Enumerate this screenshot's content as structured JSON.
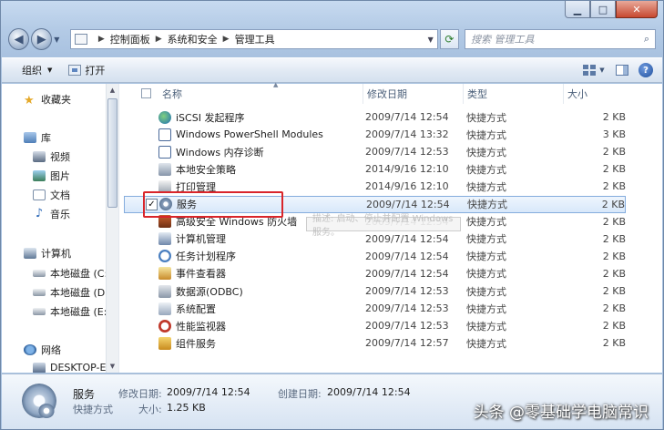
{
  "window": {
    "caption_min": "▁",
    "caption_max": "□",
    "caption_close": "✕"
  },
  "address": {
    "crumbs": [
      "控制面板",
      "系统和安全",
      "管理工具"
    ],
    "search_placeholder": "搜索 管理工具"
  },
  "toolbar": {
    "organize_label": "组织",
    "open_label": "打开"
  },
  "nav": {
    "favorites": "收藏夹",
    "libraries": "库",
    "videos": "视频",
    "pictures": "图片",
    "documents": "文档",
    "music": "音乐",
    "computer": "计算机",
    "drive_c": "本地磁盘 (C:)",
    "drive_d": "本地磁盘 (D:)",
    "drive_e": "本地磁盘 (E:)",
    "network": "网络",
    "desktop": "DESKTOP-EQ"
  },
  "columns": {
    "name": "名称",
    "modified": "修改日期",
    "type": "类型",
    "size": "大小"
  },
  "files": [
    {
      "name": "iSCSI 发起程序",
      "date": "2009/7/14 12:54",
      "type": "快捷方式",
      "size": "2 KB",
      "icon": "globe-icon"
    },
    {
      "name": "Windows PowerShell Modules",
      "date": "2009/7/14 13:32",
      "type": "快捷方式",
      "size": "3 KB",
      "icon": "powershell-icon"
    },
    {
      "name": "Windows 内存诊断",
      "date": "2009/7/14 12:53",
      "type": "快捷方式",
      "size": "2 KB",
      "icon": "memory-icon"
    },
    {
      "name": "本地安全策略",
      "date": "2014/9/16 12:10",
      "type": "快捷方式",
      "size": "2 KB",
      "icon": "security-policy-icon"
    },
    {
      "name": "打印管理",
      "date": "2014/9/16 12:10",
      "type": "快捷方式",
      "size": "2 KB",
      "icon": "print-icon"
    },
    {
      "name": "服务",
      "date": "2009/7/14 12:54",
      "type": "快捷方式",
      "size": "2 KB",
      "icon": "services-gear-icon"
    },
    {
      "name": "高级安全 Windows 防火墙",
      "date": "2009/7/14 12:54",
      "type": "快捷方式",
      "size": "2 KB",
      "icon": "firewall-icon"
    },
    {
      "name": "计算机管理",
      "date": "2009/7/14 12:54",
      "type": "快捷方式",
      "size": "2 KB",
      "icon": "computer-mgmt-icon"
    },
    {
      "name": "任务计划程序",
      "date": "2009/7/14 12:54",
      "type": "快捷方式",
      "size": "2 KB",
      "icon": "clock-icon"
    },
    {
      "name": "事件查看器",
      "date": "2009/7/14 12:54",
      "type": "快捷方式",
      "size": "2 KB",
      "icon": "event-viewer-icon"
    },
    {
      "name": "数据源(ODBC)",
      "date": "2009/7/14 12:53",
      "type": "快捷方式",
      "size": "2 KB",
      "icon": "database-icon"
    },
    {
      "name": "系统配置",
      "date": "2009/7/14 12:53",
      "type": "快捷方式",
      "size": "2 KB",
      "icon": "system-config-icon"
    },
    {
      "name": "性能监视器",
      "date": "2009/7/14 12:53",
      "type": "快捷方式",
      "size": "2 KB",
      "icon": "performance-icon"
    },
    {
      "name": "组件服务",
      "date": "2009/7/14 12:57",
      "type": "快捷方式",
      "size": "2 KB",
      "icon": "component-services-icon"
    }
  ],
  "selected_index": 5,
  "tooltip_text": "描述: 启动、停止并配置 Windows 服务。",
  "details": {
    "name": "服务",
    "type": "快捷方式",
    "modified_label": "修改日期:",
    "modified_value": "2009/7/14 12:54",
    "created_label": "创建日期:",
    "created_value": "2009/7/14 12:54",
    "size_label": "大小:",
    "size_value": "1.25 KB"
  },
  "watermark": "头条 @零基础学电脑常识"
}
